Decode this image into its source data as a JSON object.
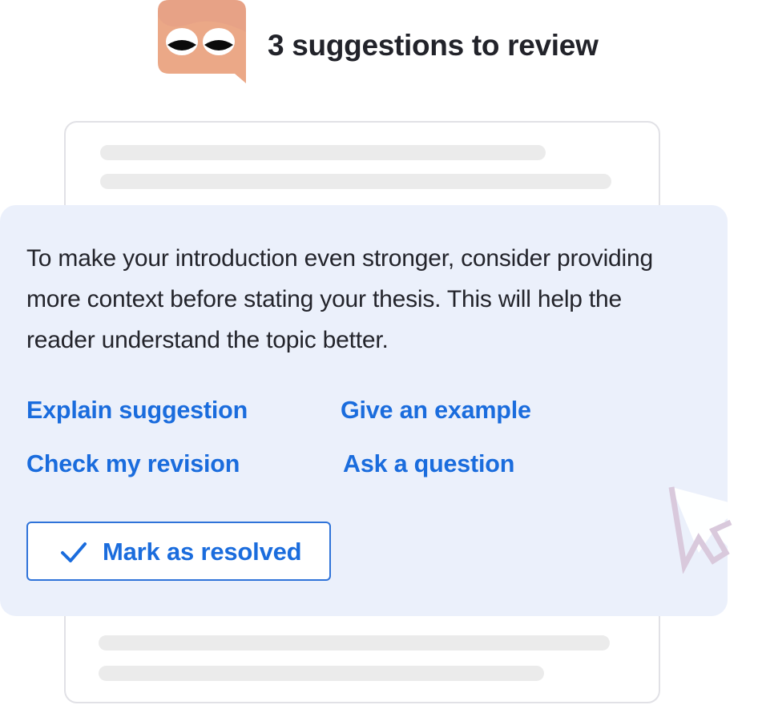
{
  "header": {
    "title": "3 suggestions to review",
    "avatar_icon": "eyes-speech-bubble-icon",
    "avatar_color": "#eba887"
  },
  "suggestion": {
    "text": "To make your introduction even stronger, consider providing more context before stating your thesis. This will help the reader understand the topic better.",
    "actions": {
      "explain": "Explain suggestion",
      "example": "Give an example",
      "check": "Check my revision",
      "ask": "Ask a question"
    },
    "resolve_label": "Mark as resolved",
    "resolve_icon": "checkmark-icon"
  },
  "colors": {
    "accent": "#1a6cdd",
    "card_background": "#ebf0fb",
    "text": "#23242b"
  },
  "cursor_icon": "mouse-pointer-icon"
}
